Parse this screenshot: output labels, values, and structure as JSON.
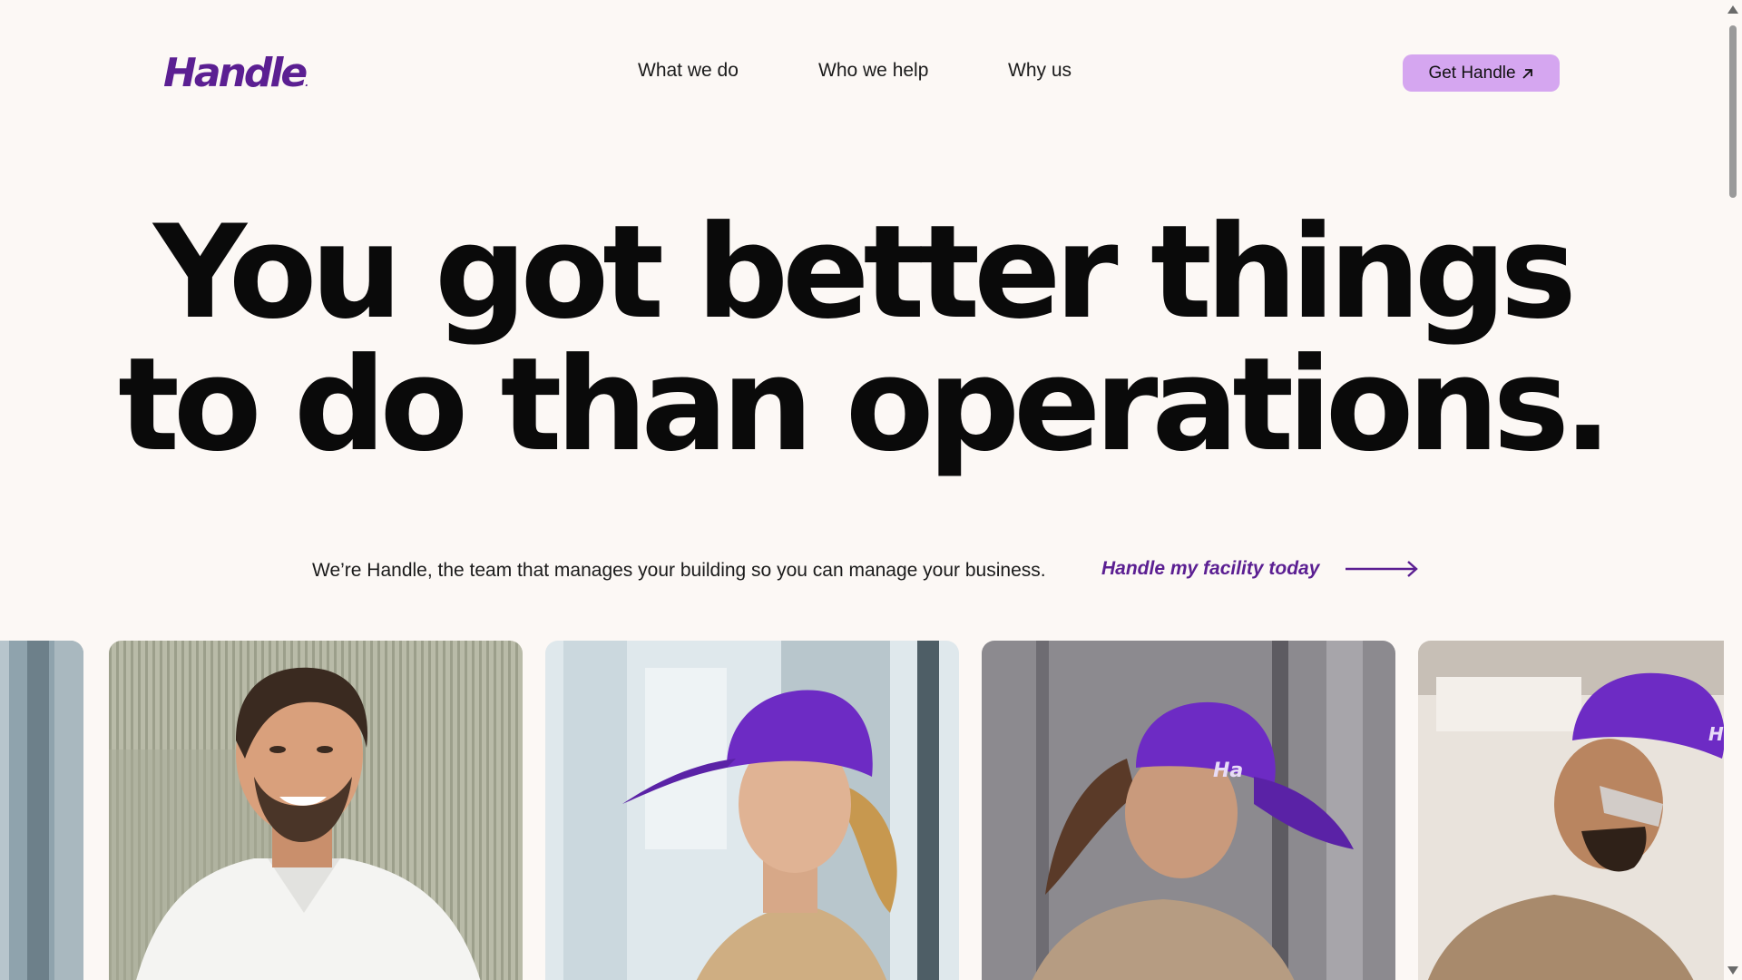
{
  "brand": {
    "name": "Handle",
    "mark": ".",
    "color": "#5b1f92"
  },
  "nav": {
    "items": [
      {
        "label": "What we do"
      },
      {
        "label": "Who we help"
      },
      {
        "label": "Why us"
      }
    ],
    "cta_label": "Get Handle",
    "cta_icon": "arrow-up-right-icon",
    "cta_color": "#d5a6f0"
  },
  "hero": {
    "line1": "You got better things",
    "line2": "to do than operations."
  },
  "intro": {
    "text": "We’re Handle, the team that manages your building so you can manage your business.",
    "link_label": "Handle my facility today",
    "link_icon": "long-arrow-right-icon"
  },
  "photos": [
    {
      "name": "photo-partial-left"
    },
    {
      "name": "photo-smiling-man-white-polo"
    },
    {
      "name": "photo-woman-purple-cap-profile"
    },
    {
      "name": "photo-worker-purple-cap-writing",
      "cap_text": "Ha"
    },
    {
      "name": "photo-technician-safety-glasses",
      "cap_text": "H"
    }
  ],
  "colors": {
    "background": "#fcf8f5",
    "accent": "#5b1f92",
    "cap_purple": "#6d2bc4"
  }
}
